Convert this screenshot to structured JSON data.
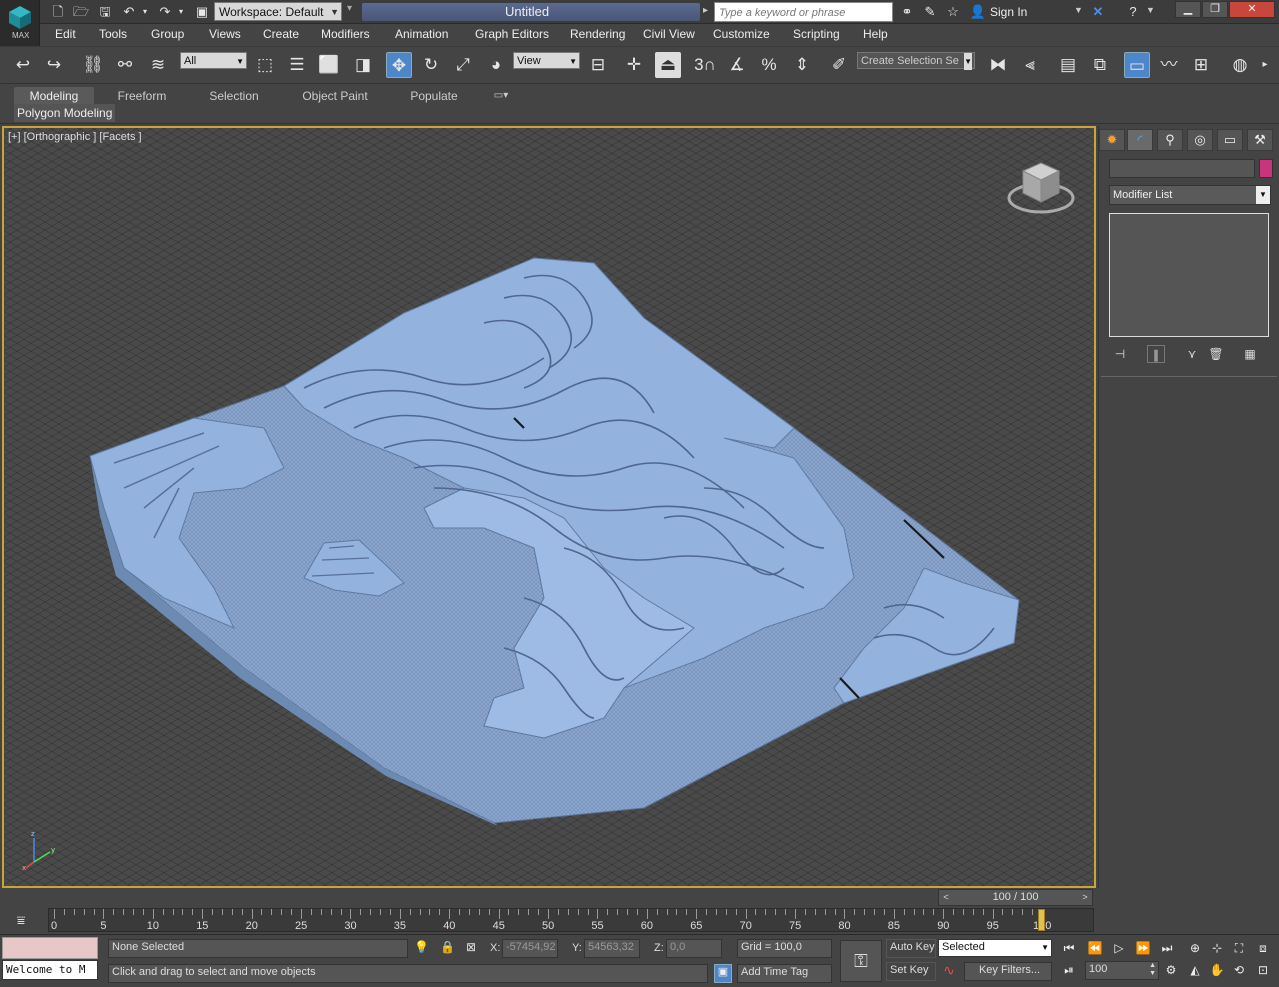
{
  "titlebar": {
    "workspace_label": "Workspace: Default",
    "app_title": "Untitled",
    "search_placeholder": "Type a keyword or phrase",
    "sign_in": "Sign In",
    "logo_text": "MAX"
  },
  "menu": [
    "Edit",
    "Tools",
    "Group",
    "Views",
    "Create",
    "Modifiers",
    "Animation",
    "Graph Editors",
    "Rendering",
    "Civil View",
    "Customize",
    "Scripting",
    "Help"
  ],
  "toolbar": {
    "filter_value": "All",
    "ref_coord_value": "View",
    "selection_set_placeholder": "Create Selection Se",
    "snap_label": "3"
  },
  "ribbon": {
    "tabs": [
      "Modeling",
      "Freeform",
      "Selection",
      "Object Paint",
      "Populate"
    ],
    "active_tab": "Modeling",
    "panel_label": "Polygon Modeling"
  },
  "viewport": {
    "label": "[+] [Orthographic ] [Facets ]",
    "terrain_color": "#8fb0dc"
  },
  "command_panel": {
    "modifier_list": "Modifier List",
    "object_color": "#c8357d"
  },
  "timeline": {
    "frame_display": "100 / 100",
    "ticks": [
      "0",
      "5",
      "10",
      "15",
      "20",
      "25",
      "30",
      "35",
      "40",
      "45",
      "50",
      "55",
      "60",
      "65",
      "70",
      "75",
      "80",
      "85",
      "90",
      "95",
      "100"
    ],
    "current_frame": 100
  },
  "status": {
    "maxscript_text": "Welcome to M",
    "selection_text": "None Selected",
    "prompt_text": "Click and drag to select and move objects",
    "x_label": "X:",
    "x_value": "-57454,92",
    "y_label": "Y:",
    "y_value": "54563,32",
    "z_label": "Z:",
    "z_value": "0,0",
    "grid_text": "Grid = 100,0",
    "add_time_tag": "Add Time Tag",
    "auto_key": "Auto Key",
    "set_key": "Set Key",
    "key_mode_value": "Selected",
    "key_filters": "Key Filters...",
    "frame_value": "100"
  }
}
